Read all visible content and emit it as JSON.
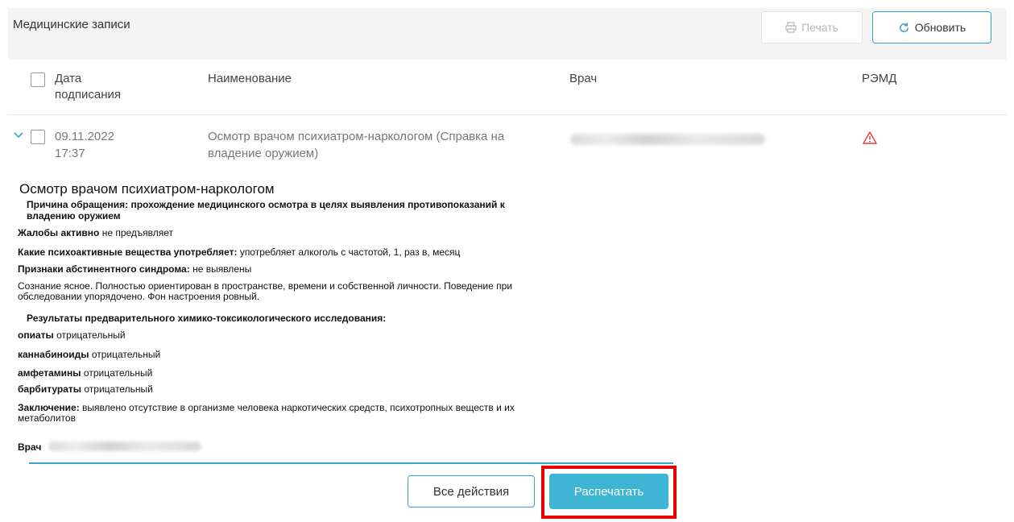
{
  "header": {
    "title": "Медицинские записи",
    "print_label": "Печать",
    "refresh_label": "Обновить"
  },
  "table": {
    "columns": {
      "date_line1": "Дата",
      "date_line2": "подписания",
      "name": "Наименование",
      "doctor": "Врач",
      "remd": "РЭМД"
    },
    "rows": [
      {
        "date": "09.11.2022",
        "time": "17:37",
        "name_line1": "Осмотр врачом психиатром-наркологом (Справка на",
        "name_line2": "владение оружием)",
        "remd_status": "warning-icon"
      }
    ]
  },
  "document": {
    "title": "Осмотр врачом психиатром-наркологом",
    "reason_label": "Причина обращения:",
    "reason_value_line1": "прохождение медицинского осмотра в целях выявления противопоказаний к",
    "reason_value_line2": "владению оружием",
    "complaints_label": "Жалобы активно",
    "complaints_value": "не предъявляет",
    "substances_label": "Какие психоактивные вещества употребляет:",
    "substances_value": "употребляет алкоголь с частотой, 1, раз в, месяц",
    "withdrawal_label": "Признаки абстинентного синдрома:",
    "withdrawal_value": "не выявлены",
    "status_line1": "Сознание ясное. Полностью ориентирован в пространстве, времени и собственной личности. Поведение при",
    "status_line2": "обследовании упорядочено. Фон настроения ровный.",
    "results_heading": "Результаты предварительного химико-токсикологического исследования:",
    "results": [
      {
        "label": "опиаты",
        "value": "отрицательный"
      },
      {
        "label": "каннабиноиды",
        "value": "отрицательный"
      },
      {
        "label": "амфетамины",
        "value": "отрицательный"
      },
      {
        "label": "барбитураты",
        "value": "отрицательный"
      }
    ],
    "conclusion_label": "Заключение:",
    "conclusion_value_line1": "выявлено отсутствие в организме человека наркотических средств, психотропных веществ и их",
    "conclusion_value_line2": "метаболитов",
    "doctor_label": "Врач"
  },
  "actions": {
    "all_actions_label": "Все действия",
    "print_label": "Распечатать"
  },
  "colors": {
    "accent": "#3aa0c9",
    "primary_button": "#3fb5d6",
    "highlight": "#e60000",
    "warning": "#e53935"
  }
}
